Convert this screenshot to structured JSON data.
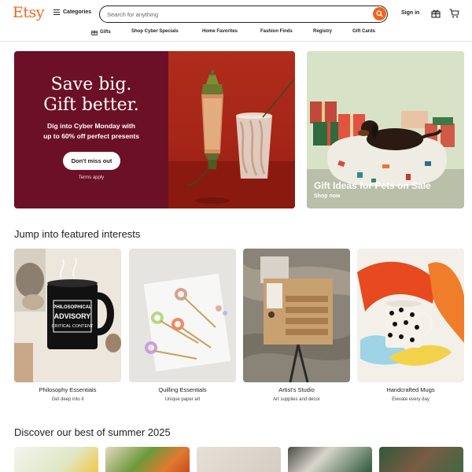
{
  "header": {
    "logo": "Etsy",
    "categories_label": "Categories",
    "search_placeholder": "Search for anything",
    "signin_label": "Sign in"
  },
  "nav": {
    "items": [
      "Gifts",
      "Shop Cyber Specials",
      "Home Favorites",
      "Fashion Finds",
      "Registry",
      "Gift Cards"
    ]
  },
  "hero": {
    "headline_line1": "Save big.",
    "headline_line2": "Gift better.",
    "subtext_line1": "Dig into Cyber Monday with",
    "subtext_line2": "up to 60% off perfect presents",
    "button_label": "Don't miss out",
    "terms": "Terms apply",
    "bg_color": "#6b1026"
  },
  "promo": {
    "title": "Gift Ideas for Pets on Sale",
    "link": "Shop now"
  },
  "featured": {
    "title": "Jump into featured interests",
    "cards": [
      {
        "title": "Philosophy Essentials",
        "subtitle": "Get deep into it",
        "mug_text_1": "PHILOSOPHICAL",
        "mug_text_2": "ADVISORY",
        "mug_text_3": "CRITICAL CONTENT"
      },
      {
        "title": "Quilling Essentials",
        "subtitle": "Unique paper art"
      },
      {
        "title": "Artist's Studio",
        "subtitle": "Art supplies and decor"
      },
      {
        "title": "Handcrafted Mugs",
        "subtitle": "Elevate every day"
      }
    ]
  },
  "summer": {
    "title": "Discover our best of summer 2025"
  },
  "colors": {
    "brand": "#F1641E",
    "text": "#222222"
  }
}
